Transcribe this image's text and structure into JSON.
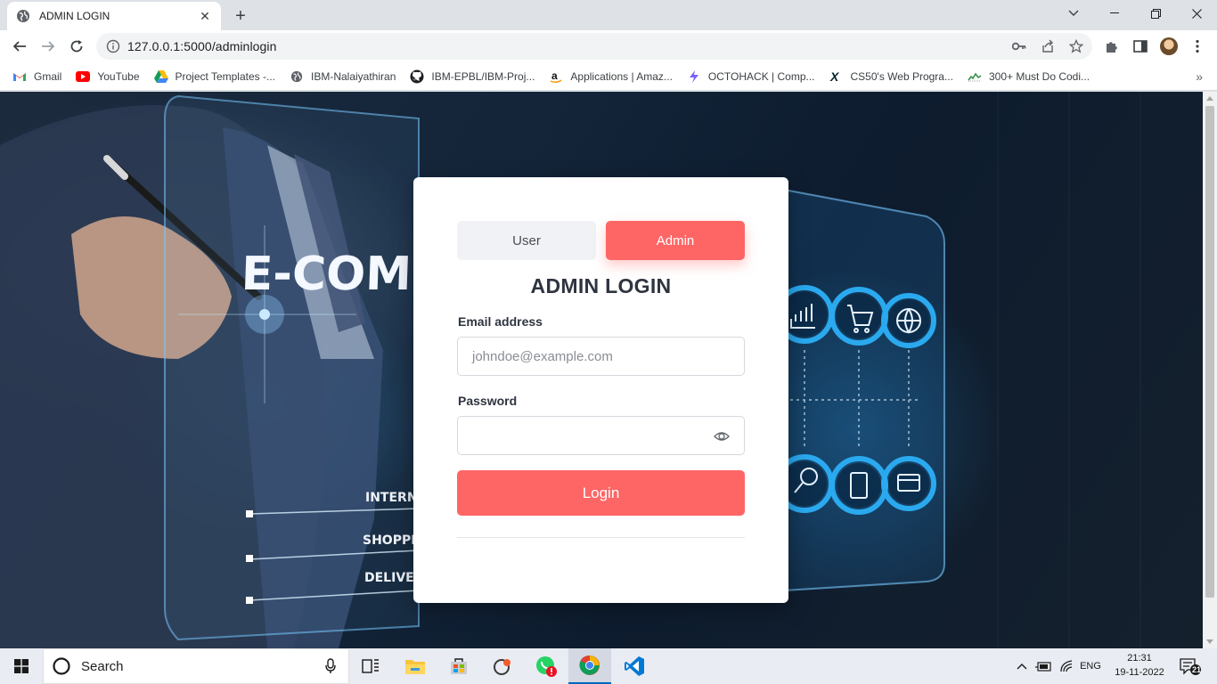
{
  "browser": {
    "tab_title": "ADMIN LOGIN",
    "url": "127.0.0.1:5000/adminlogin"
  },
  "bookmarks": [
    {
      "label": "Gmail",
      "icon": "gmail-icon"
    },
    {
      "label": "YouTube",
      "icon": "youtube-icon"
    },
    {
      "label": "Project Templates -...",
      "icon": "drive-icon"
    },
    {
      "label": "IBM-Nalaiyathiran",
      "icon": "globe-icon"
    },
    {
      "label": "IBM-EPBL/IBM-Proj...",
      "icon": "github-icon"
    },
    {
      "label": "Applications | Amaz...",
      "icon": "amazon-icon"
    },
    {
      "label": "OCTOHACK | Comp...",
      "icon": "octohack-icon"
    },
    {
      "label": "CS50's Web Progra...",
      "icon": "edx-icon"
    },
    {
      "label": "300+ Must Do Codi...",
      "icon": "gfg-icon"
    }
  ],
  "page": {
    "background_overlay": {
      "lines": [
        "E-COM",
        "INTERN",
        "SHOPPI",
        "DELIVE"
      ]
    },
    "login": {
      "tab_user": "User",
      "tab_admin": "Admin",
      "active_tab": "Admin",
      "title": "ADMIN LOGIN",
      "email_label": "Email address",
      "email_placeholder": "johndoe@example.com",
      "email_value": "",
      "password_label": "Password",
      "password_value": "",
      "login_button": "Login"
    },
    "accent_color": "#fe6666"
  },
  "taskbar": {
    "search_placeholder": "Search",
    "language": "ENG",
    "time": "21:31",
    "date": "19-11-2022",
    "notification_count": "21"
  }
}
